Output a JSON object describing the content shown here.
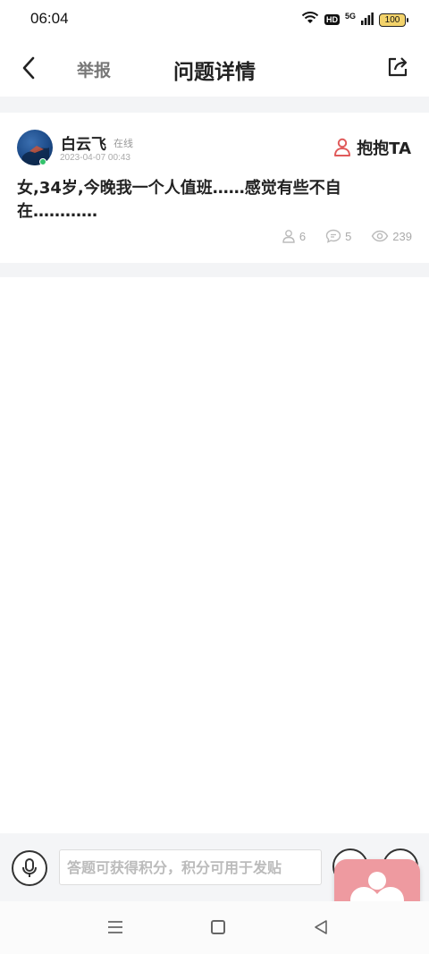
{
  "status_bar": {
    "time": "06:04",
    "hd_label": "HD",
    "network_label": "5G",
    "battery": "100"
  },
  "header": {
    "report_label": "举报",
    "title": "问题详情"
  },
  "question": {
    "user_name": "白云飞",
    "online_label": "在线",
    "post_time": "2023-04-07  00:43",
    "hug_label": "抱抱TA",
    "text": "女,34岁,今晚我一个人值班……感觉有些不自在…………",
    "stats": {
      "hugs": "6",
      "comments": "5",
      "views": "239"
    }
  },
  "answer_bar": {
    "placeholder": "答题可获得积分，积分可用于发贴"
  },
  "colors": {
    "accent": "#e05a5a",
    "floating_heart_bg": "#ee9aa0",
    "online": "#32c26b"
  }
}
